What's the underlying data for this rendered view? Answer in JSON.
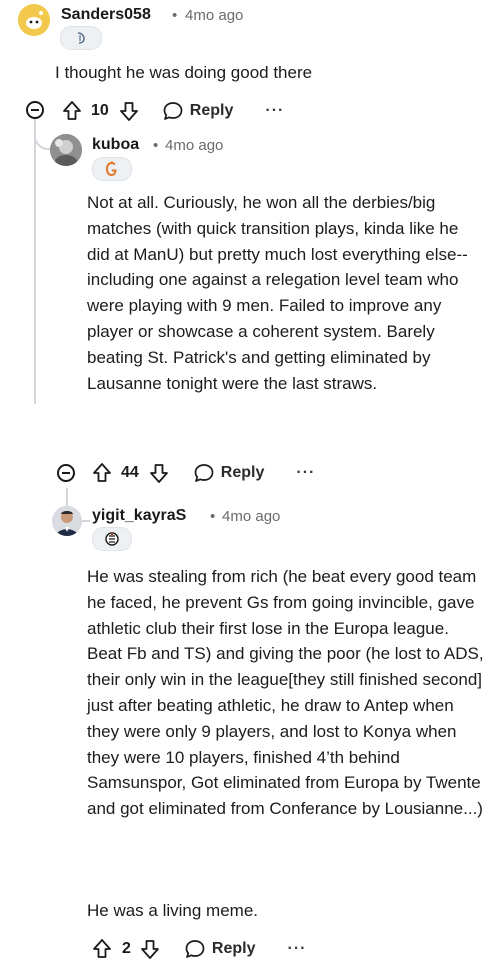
{
  "comments": [
    {
      "username": "Sanders058",
      "time": "4mo ago",
      "body": "I thought he was doing good there",
      "votes": "10",
      "reply_label": "Reply",
      "more_label": "···"
    },
    {
      "username": "kuboa",
      "time": "4mo ago",
      "body": "Not at all. Curiously, he won all the derbies/big matches (with quick transition plays, kinda like he did at ManU) but pretty much lost everything else--including one against a relegation level team who were playing with 9 men. Failed to improve any player or showcase a coherent system. Barely beating St. Patrick's and getting eliminated by Lausanne tonight were the last straws.",
      "votes": "44",
      "reply_label": "Reply",
      "more_label": "···"
    },
    {
      "username": "yigit_kayraS",
      "time": "4mo ago",
      "body_p1": "He was stealing from rich (he beat every good team he faced, he prevent Gs from going invincible, gave athletic club their first lose in the Europa league. Beat Fb and TS) and giving the poor (he lost to ADS, their only win in the league[they still finished second] just after beating athletic, he draw to Antep when they were only 9 players, and lost to Konya when they were 10 players, finished 4’th behind Samsunspor, Got eliminated from Europa by Twente and got eliminated from Conferance by Lousianne...)",
      "body_p2": "He was a living meme.",
      "votes": "2",
      "reply_label": "Reply",
      "more_label": "···"
    }
  ],
  "separator": "•",
  "colors": {
    "text": "#1a1a1b",
    "meta": "#6b6b6b",
    "thread": "#d3d6da",
    "galatasaray": "#e07a2a",
    "avatar1": "#f2c94c"
  }
}
